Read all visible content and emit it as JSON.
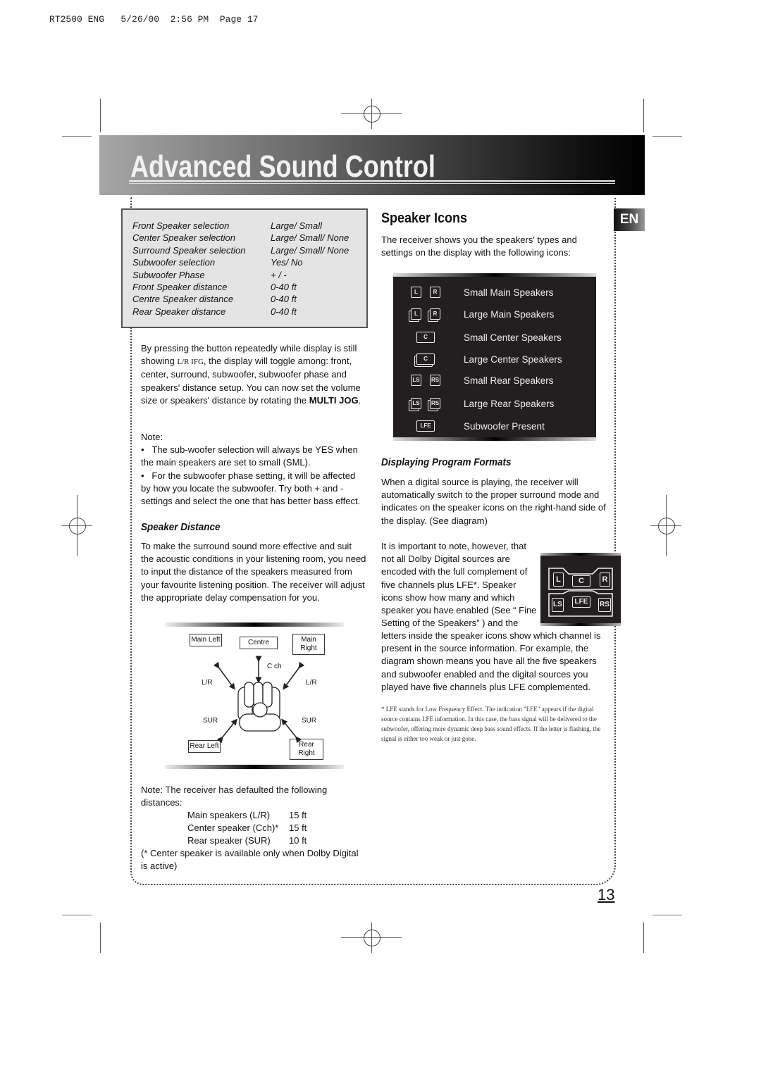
{
  "print_slug": "RT2500 ENG   5/26/00  2:56 PM  Page 17",
  "banner": {
    "title": "Advanced Sound Control"
  },
  "language_badge": "EN",
  "settings_table": [
    {
      "label": "Front Speaker selection",
      "value": "Large/ Small"
    },
    {
      "label": "Center Speaker selection",
      "value": "Large/ Small/ None"
    },
    {
      "label": "Surround Speaker selection",
      "value": "Large/ Small/ None"
    },
    {
      "label": "Subwoofer selection",
      "value": "Yes/ No"
    },
    {
      "label": "Subwoofer Phase",
      "value": "+ / -"
    },
    {
      "label": "Front Speaker distance",
      "value": "0-40 ft"
    },
    {
      "label": "Centre Speaker distance",
      "value": "0-40 ft"
    },
    {
      "label": "Rear Speaker distance",
      "value": "0-40 ft"
    }
  ],
  "left": {
    "intro_p1": "By pressing the button repeatedly while display is still showing ",
    "intro_display": "L/R IFG",
    "intro_p2": ", the display will toggle among: front, center, surround, subwoofer, subwoofer phase and speakers' distance setup. You can now set the volume size or speakers' distance  by rotating the ",
    "intro_bold": "MULTI JOG",
    "intro_end": ".",
    "note_title": "Note:",
    "note_bullets": [
      "The sub-woofer selection will always be YES when the main speakers are set to small (SML).",
      "For the subwoofer phase setting, it will be affected by how you locate the subwoofer. Try both + and - settings and select the one that has better bass effect."
    ],
    "speaker_distance_heading": "Speaker Distance",
    "speaker_distance_text": "To make the surround sound more effective and suit the acoustic conditions in your listening room, you need to input the distance of the speakers measured from your favourite listening position. The receiver will adjust the appropriate delay compensation for you.",
    "diagram": {
      "main_left": "Main Left",
      "centre": "Centre",
      "main_right": "Main Right",
      "c_ch": "C ch",
      "lr_left": "L/R",
      "lr_right": "L/R",
      "sur_left": "SUR",
      "sur_right": "SUR",
      "rear_left": "Rear Left",
      "rear_right": "Rear Right"
    },
    "defaults_note": "Note: The receiver has defaulted the following distances:",
    "defaults": [
      {
        "name": "Main speakers (L/R)",
        "value": "15 ft"
      },
      {
        "name": "Center speaker (Cch)*",
        "value": "15 ft"
      },
      {
        "name": "Rear speaker (SUR)",
        "value": "10 ft"
      }
    ],
    "center_footnote": "(* Center speaker is available only when Dolby Digital is active)"
  },
  "right": {
    "speaker_icons_heading": "Speaker Icons",
    "speaker_icons_intro": "The receiver shows you the speakers' types and settings on the display with the following icons:",
    "icons": [
      {
        "glyphs": [
          "L",
          "R"
        ],
        "size": "small",
        "label": "Small Main Speakers"
      },
      {
        "glyphs": [
          "L",
          "R"
        ],
        "size": "large",
        "label": "Large Main Speakers"
      },
      {
        "glyphs": [
          "C"
        ],
        "size": "small",
        "label": "Small Center Speakers"
      },
      {
        "glyphs": [
          "C"
        ],
        "size": "large",
        "label": "Large Center Speakers"
      },
      {
        "glyphs": [
          "LS",
          "RS"
        ],
        "size": "small",
        "label": "Small Rear Speakers"
      },
      {
        "glyphs": [
          "LS",
          "RS"
        ],
        "size": "large",
        "label": "Large Rear Speakers"
      },
      {
        "glyphs": [
          "LFE"
        ],
        "size": "small",
        "label": "Subwoofer Present"
      }
    ],
    "program_formats_heading": "Displaying Program Formats",
    "program_formats_text": "When a digital source is playing, the receiver will automatically switch to the proper surround mode and indicates on the speaker icons on the right-hand side of the display. (See diagram)",
    "important_text_wrapped": "It is important to note, however, that not all Dolby Digital sources are encoded with the full complement of five channels plus LFE*. Speaker icons show how many and which speaker you have enabled (See “ Fine Setting of the Speakers” ) and the",
    "important_text_full": "letters inside the speaker icons show which channel is present in the source information. For example, the diagram shown means you have all the five speakers and subwoofer enabled and the digital sources you played have five channels plus LFE complemented.",
    "program_icon_letters": {
      "l": "L",
      "c": "C",
      "r": "R",
      "ls": "LS",
      "lfe": "LFE",
      "rs": "RS"
    },
    "lfe_footnote": "* LFE stands for Low Frequency Effect. The indication \"LFE\" appears if the digital source contains LFE information. In this case, the bass signal will be delivered to the subwoofer, offering more dynamic deep bass sound effects. If the letter is flashing, the signal is either too weak or just gone."
  },
  "page_number": "13"
}
